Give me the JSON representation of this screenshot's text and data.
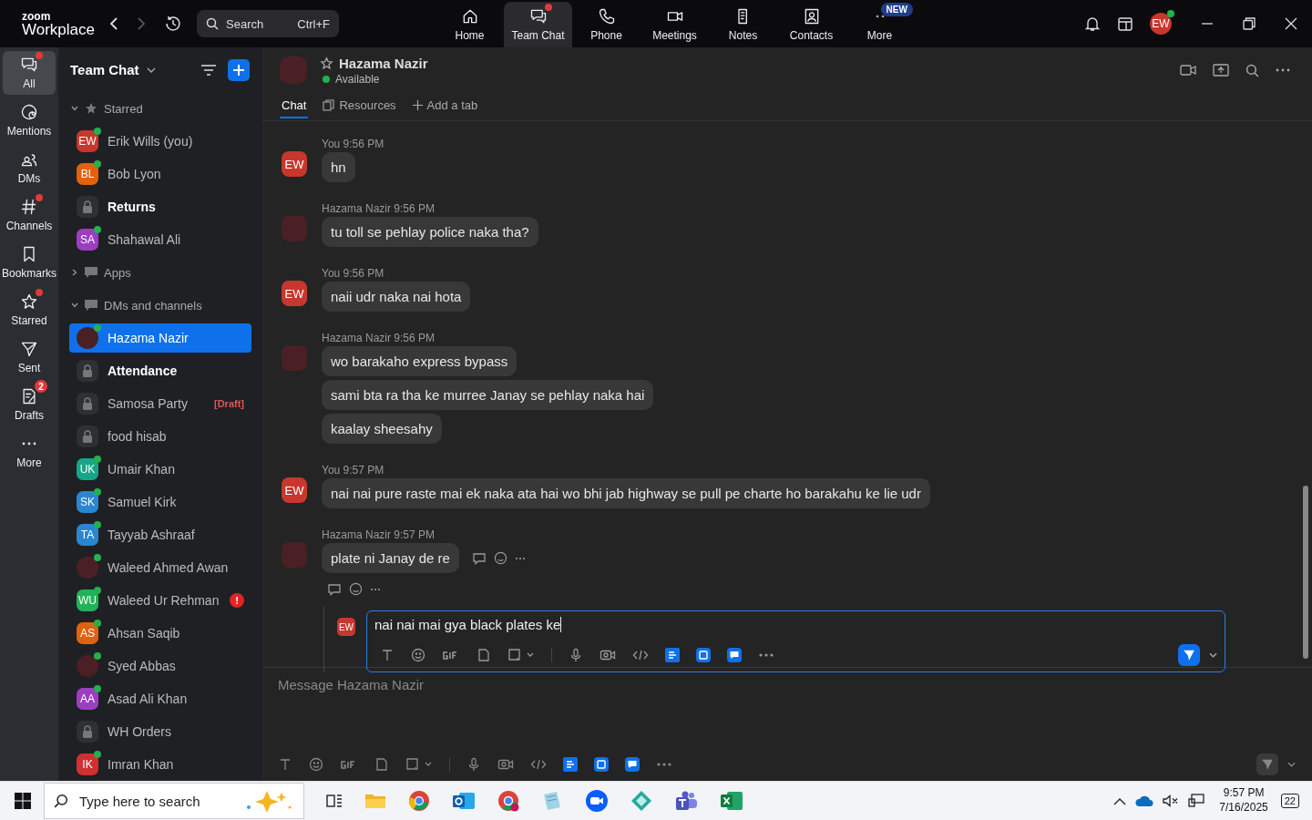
{
  "brand": {
    "top": "zoom",
    "bottom": "Workplace"
  },
  "search": {
    "placeholder": "Search",
    "shortcut": "Ctrl+F"
  },
  "nav": [
    {
      "label": "Home",
      "kind": "home",
      "selected": false,
      "dot": false
    },
    {
      "label": "Team Chat",
      "kind": "chat",
      "selected": true,
      "dot": true
    },
    {
      "label": "Phone",
      "kind": "phone",
      "selected": false,
      "dot": false
    },
    {
      "label": "Meetings",
      "kind": "video",
      "selected": false,
      "dot": false
    },
    {
      "label": "Notes",
      "kind": "notes",
      "selected": false,
      "dot": false
    },
    {
      "label": "Contacts",
      "kind": "contacts",
      "selected": false,
      "dot": false
    },
    {
      "label": "More",
      "kind": "more",
      "selected": false,
      "dot": false,
      "badge": "NEW"
    }
  ],
  "user": {
    "initials": "EW",
    "online": true
  },
  "rail": [
    {
      "label": "All",
      "kind": "chat",
      "selected": true,
      "dot": true
    },
    {
      "label": "Mentions",
      "kind": "at",
      "selected": false,
      "dot": false
    },
    {
      "label": "DMs",
      "kind": "people",
      "selected": false,
      "dot": false
    },
    {
      "label": "Channels",
      "kind": "hash",
      "selected": false,
      "dot": true
    },
    {
      "label": "Bookmarks",
      "kind": "bookmark",
      "selected": false,
      "dot": false
    },
    {
      "label": "Starred",
      "kind": "star",
      "selected": false,
      "dot": true
    },
    {
      "label": "Sent",
      "kind": "send",
      "selected": false,
      "dot": false
    },
    {
      "label": "Drafts",
      "kind": "draft",
      "selected": false,
      "dot": false,
      "count": "2"
    },
    {
      "label": "More",
      "kind": "more",
      "selected": false,
      "dot": false
    }
  ],
  "sidebar": {
    "title": "Team Chat",
    "sections": [
      {
        "label": "Starred",
        "kind": "star",
        "expanded": true,
        "items": [
          {
            "name": "Erik Wills (you)",
            "kind": "avatar",
            "initials": "EW",
            "color": "#c8372d",
            "online": true,
            "bold": false,
            "selected": false
          },
          {
            "name": "Bob Lyon",
            "kind": "avatar",
            "initials": "BL",
            "color": "#e0620f",
            "online": true,
            "bold": false,
            "selected": false
          },
          {
            "name": "Returns",
            "kind": "channel",
            "online": false,
            "bold": true,
            "selected": false
          },
          {
            "name": "Shahawal Ali",
            "kind": "avatar",
            "initials": "SA",
            "color": "#9b3fc0",
            "online": true,
            "bold": false,
            "selected": false
          }
        ]
      },
      {
        "label": "Apps",
        "kind": "bubble",
        "expanded": false
      },
      {
        "label": "DMs and channels",
        "kind": "bubble",
        "expanded": true,
        "items": [
          {
            "name": "Hazama Nazir",
            "kind": "photo",
            "online": true,
            "bold": false,
            "selected": true
          },
          {
            "name": "Attendance",
            "kind": "channel",
            "online": false,
            "bold": true,
            "selected": false
          },
          {
            "name": "Samosa Party",
            "kind": "channel",
            "online": false,
            "bold": false,
            "selected": false,
            "draft": "[Draft]"
          },
          {
            "name": "food hisab",
            "kind": "channel",
            "online": false,
            "bold": false,
            "selected": false
          },
          {
            "name": "Umair Khan",
            "kind": "avatar",
            "initials": "UK",
            "color": "#17a589",
            "online": true,
            "bold": false,
            "selected": false
          },
          {
            "name": "Samuel Kirk",
            "kind": "avatar",
            "initials": "SK",
            "color": "#2a86d1",
            "online": true,
            "bold": false,
            "selected": false
          },
          {
            "name": "Tayyab Ashraaf",
            "kind": "avatar",
            "initials": "TA",
            "color": "#2a86d1",
            "online": true,
            "bold": false,
            "selected": false
          },
          {
            "name": "Waleed Ahmed Awan",
            "kind": "photo",
            "online": true,
            "bold": false,
            "selected": false
          },
          {
            "name": "Waleed Ur Rehman",
            "kind": "avatar",
            "initials": "WU",
            "color": "#22b35a",
            "online": true,
            "bold": false,
            "selected": false,
            "alert": "!"
          },
          {
            "name": "Ahsan Saqib",
            "kind": "avatar",
            "initials": "AS",
            "color": "#e0620f",
            "online": true,
            "bold": false,
            "selected": false
          },
          {
            "name": "Syed Abbas",
            "kind": "photo",
            "online": true,
            "bold": false,
            "selected": false
          },
          {
            "name": "Asad Ali Khan",
            "kind": "avatar",
            "initials": "AA",
            "color": "#9b3fc0",
            "online": true,
            "bold": false,
            "selected": false
          },
          {
            "name": "WH Orders",
            "kind": "channel",
            "online": false,
            "bold": false,
            "selected": false
          },
          {
            "name": "Imran Khan",
            "kind": "avatar",
            "initials": "IK",
            "color": "#d03030",
            "online": true,
            "bold": false,
            "selected": false
          }
        ]
      }
    ]
  },
  "chat": {
    "name": "Hazama Nazir",
    "status": "Available",
    "starred": false,
    "tabs": [
      {
        "label": "Chat",
        "kind": "text",
        "selected": true
      },
      {
        "label": "Resources",
        "kind": "files",
        "selected": false
      },
      {
        "label": "Add a tab",
        "kind": "add",
        "selected": false
      }
    ],
    "groups": [
      {
        "sender": "You",
        "time": "9:56 PM",
        "mine": true,
        "initials": "EW",
        "messages": [
          "hn"
        ]
      },
      {
        "sender": "Hazama Nazir",
        "time": "9:56 PM",
        "mine": false,
        "messages": [
          "tu toll se pehlay police naka tha?"
        ]
      },
      {
        "sender": "You",
        "time": "9:56 PM",
        "mine": true,
        "initials": "EW",
        "messages": [
          "naii udr naka nai hota"
        ]
      },
      {
        "sender": "Hazama Nazir",
        "time": "9:56 PM",
        "mine": false,
        "messages": [
          "wo barakaho express bypass",
          "sami bta ra tha ke murree Janay se pehlay naka hai",
          "kaalay sheesahy"
        ]
      },
      {
        "sender": "You",
        "time": "9:57 PM",
        "mine": true,
        "initials": "EW",
        "messages": [
          "nai nai pure raste mai ek naka ata hai wo bhi jab highway se pull pe charte ho barakahu ke lie udr"
        ]
      },
      {
        "sender": "Hazama Nazir",
        "time": "9:57 PM",
        "mine": false,
        "hovered": true,
        "messages": [
          "plate ni Janay de re"
        ]
      }
    ],
    "reply": {
      "initials": "EW",
      "value": "nai nai mai gya black plates ke"
    },
    "composer": {
      "placeholder": "Message Hazama Nazir"
    }
  },
  "taskbar": {
    "search_placeholder": "Type here to search",
    "time": "9:57 PM",
    "date": "7/16/2025",
    "notifications": "22"
  }
}
